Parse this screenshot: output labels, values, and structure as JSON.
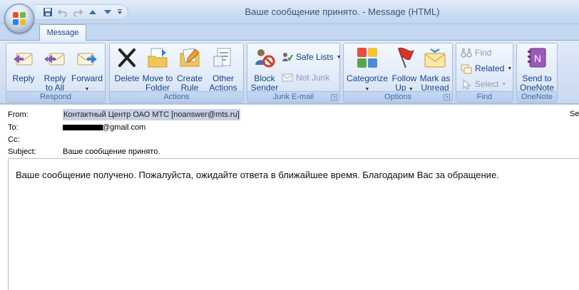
{
  "window": {
    "title": "Ваше сообщение принято. - Message (HTML)"
  },
  "quick_access": {
    "items": [
      "save-icon",
      "undo-icon",
      "redo-icon",
      "previous-item-icon",
      "next-item-icon",
      "customize-dropdown-icon"
    ]
  },
  "tabs": [
    {
      "label": "Message"
    }
  ],
  "ribbon": {
    "respond": {
      "label": "Respond",
      "reply": "Reply",
      "reply_all_1": "Reply",
      "reply_all_2": "to All",
      "forward": "Forward"
    },
    "actions": {
      "label": "Actions",
      "delete": "Delete",
      "move_1": "Move to",
      "move_2": "Folder",
      "create_1": "Create",
      "create_2": "Rule",
      "other_1": "Other",
      "other_2": "Actions"
    },
    "junk": {
      "label": "Junk E-mail",
      "block_1": "Block",
      "block_2": "Sender",
      "safe_lists": "Safe Lists",
      "not_junk": "Not Junk"
    },
    "options": {
      "label": "Options",
      "categorize": "Categorize",
      "follow_1": "Follow",
      "follow_2": "Up",
      "mark_1": "Mark as",
      "mark_2": "Unread"
    },
    "find": {
      "label": "Find",
      "find": "Find",
      "related": "Related",
      "select": "Select"
    },
    "onenote": {
      "label": "OneNote",
      "send_1": "Send to",
      "send_2": "OneNote"
    }
  },
  "message": {
    "from_label": "From:",
    "from_value": "Контактный Центр ОАО МТС [noanswer@mts.ru]",
    "to_label": "To:",
    "to_value": "@gmail.com",
    "cc_label": "Cc:",
    "subject_label": "Subject:",
    "subject_value": "Ваше сообщение принято.",
    "sent_truncated": "Se",
    "body": "Ваше сообщение получено. Пожалуйста, ожидайте ответа в ближайшее время. Благодарим Вас за обращение."
  },
  "colors": {
    "ribbon_text": "#15428b",
    "group_label": "#3e6aaa",
    "title_text": "#3f5270"
  }
}
